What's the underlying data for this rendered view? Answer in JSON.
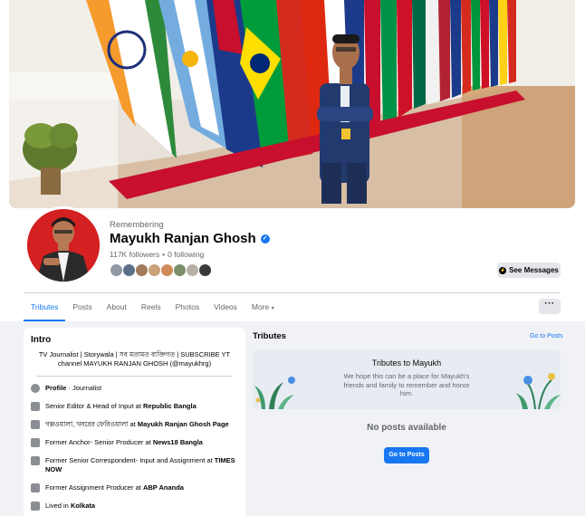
{
  "profile": {
    "remembering_label": "Remembering",
    "name": "Mayukh Ranjan Ghosh",
    "followers": "117K followers",
    "separator": "•",
    "following": "0 following",
    "see_messages_label": "See Messages",
    "verified_icon": "verified-badge-icon",
    "accent_color": "#1877f2"
  },
  "tabs": [
    {
      "label": "Tributes",
      "active": true
    },
    {
      "label": "Posts"
    },
    {
      "label": "About"
    },
    {
      "label": "Reels"
    },
    {
      "label": "Photos"
    },
    {
      "label": "Videos"
    },
    {
      "label": "More"
    }
  ],
  "more_caret": "▾",
  "more_options_label": "···",
  "intro": {
    "title": "Intro",
    "bio": "TV Journalist | Storywala | সব মতামত ব্যক্তিগত | SUBSCRIBE YT channel MAYUKH RANJAN GHOSH (@mayukhrg)",
    "items": [
      {
        "icon": "info-icon",
        "prefix": "",
        "bold_a": "Profile",
        "middle": " · Journalist",
        "bold_b": ""
      },
      {
        "icon": "work-icon",
        "prefix": "Senior Editor & Head of Input at ",
        "bold_a": "Republic Bangla",
        "middle": "",
        "bold_b": ""
      },
      {
        "icon": "work-icon",
        "prefix": "গল্পওয়ালা, খবরের ফেরিওয়ালা at ",
        "bold_a": "Mayukh Ranjan Ghosh Page",
        "middle": "",
        "bold_b": ""
      },
      {
        "icon": "work-icon",
        "prefix": "Former Anchor- Senior Producer at ",
        "bold_a": "News18 Bangla",
        "middle": "",
        "bold_b": ""
      },
      {
        "icon": "work-icon",
        "prefix": "Former Senior Correspondent- Input and Assignment at ",
        "bold_a": "TIMES NOW",
        "middle": "",
        "bold_b": ""
      },
      {
        "icon": "work-icon",
        "prefix": "Former Assignment Producer at ",
        "bold_a": "ABP Ananda",
        "middle": "",
        "bold_b": ""
      },
      {
        "icon": "home-icon",
        "prefix": "Lived in ",
        "bold_a": "Kolkata",
        "middle": "",
        "bold_b": ""
      }
    ]
  },
  "tributes": {
    "heading": "Tributes",
    "link": "Go to Posts",
    "banner_title": "Tributes to Mayukh",
    "banner_text": "We hope this can be a place for Mayukh's friends and family to remember and honor him.",
    "empty_text": "No posts available",
    "button_label": "Go to Posts"
  }
}
